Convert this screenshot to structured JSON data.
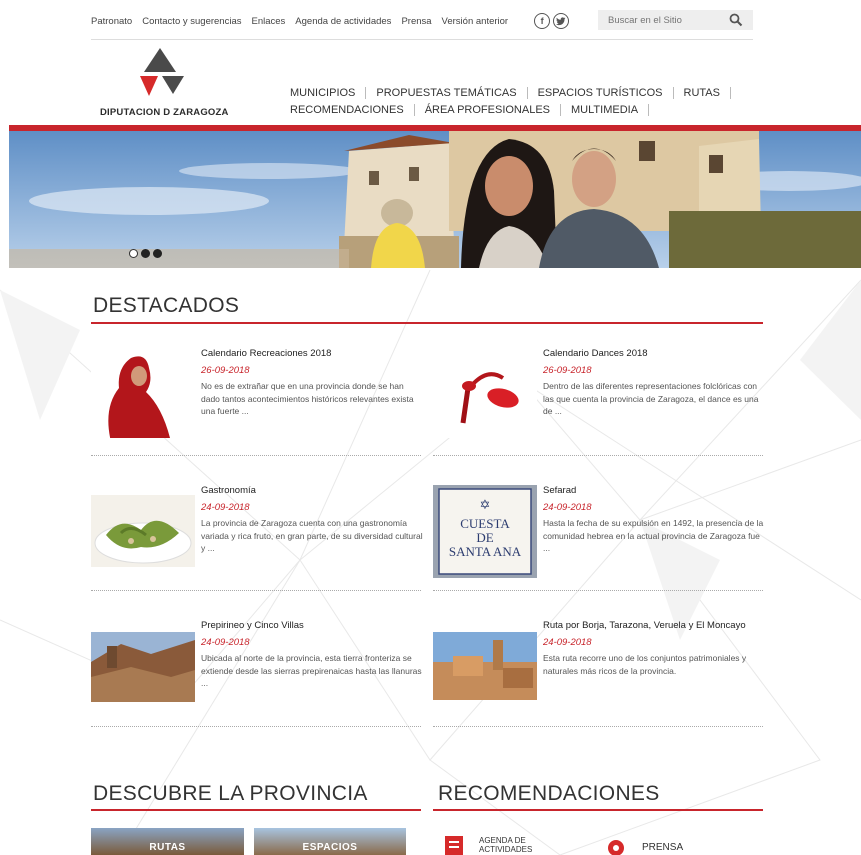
{
  "topbar": {
    "links": [
      "Patronato",
      "Contacto y sugerencias",
      "Enlaces",
      "Agenda de actividades",
      "Prensa",
      "Versión anterior"
    ],
    "social": [
      "facebook-icon",
      "twitter-icon"
    ],
    "search_placeholder": "Buscar en el Sitio"
  },
  "logo": {
    "text": "DIPUTACION D ZARAGOZA"
  },
  "nav": {
    "row1": [
      "MUNICIPIOS",
      "PROPUESTAS TEMÁTICAS",
      "ESPACIOS TURÍSTICOS",
      "RUTAS"
    ],
    "row2": [
      "RECOMENDACIONES",
      "ÁREA PROFESIONALES",
      "MULTIMEDIA"
    ]
  },
  "hero": {
    "slides": 3,
    "active_slide": 1
  },
  "destacados": {
    "title": "DESTACADOS",
    "items": [
      {
        "title": "Calendario Recreaciones 2018",
        "date": "26-09-2018",
        "desc": "No es de extrañar que en una provincia donde se han dado tantos acontecimientos históricos relevantes exista una fuerte ..."
      },
      {
        "title": "Calendario Dances 2018",
        "date": "26-09-2018",
        "desc": "Dentro de las diferentes representaciones folclóricas con las que cuenta la provincia de Zaragoza, el dance es una de ..."
      },
      {
        "title": "Gastronomía",
        "date": "24-09-2018",
        "desc": "La provincia de Zaragoza cuenta con una gastronomía variada y rica fruto, en gran parte, de su diversidad cultural y ..."
      },
      {
        "title": "Sefarad",
        "date": "24-09-2018",
        "desc": "Hasta la fecha de su expulsión en 1492, la presencia de la comunidad hebrea en la actual provincia de Zaragoza fue ..."
      },
      {
        "title": "Prepirineo y Cinco Villas",
        "date": "24-09-2018",
        "desc": "Ubicada al norte de la provincia, esta tierra fronteriza se extiende desde las sierras prepirenaicas hasta las llanuras ..."
      },
      {
        "title": "Ruta por Borja, Tarazona, Veruela y El Moncayo",
        "date": "24-09-2018",
        "desc": "Esta ruta recorre uno de los conjuntos patrimoniales y naturales más ricos de la provincia."
      }
    ],
    "sign_lines": [
      "CUESTA",
      "DE",
      "SANTA ANA"
    ]
  },
  "descubre": {
    "title": "DESCUBRE LA PROVINCIA",
    "tiles": [
      "RUTAS",
      "ESPACIOS"
    ]
  },
  "recomendaciones": {
    "title": "RECOMENDACIONES",
    "items": [
      "AGENDA DE ACTIVIDADES",
      "PRENSA"
    ]
  },
  "colors": {
    "accent": "#c8252c",
    "logo_grey": "#4a4a4a",
    "logo_red": "#d62a2a"
  }
}
